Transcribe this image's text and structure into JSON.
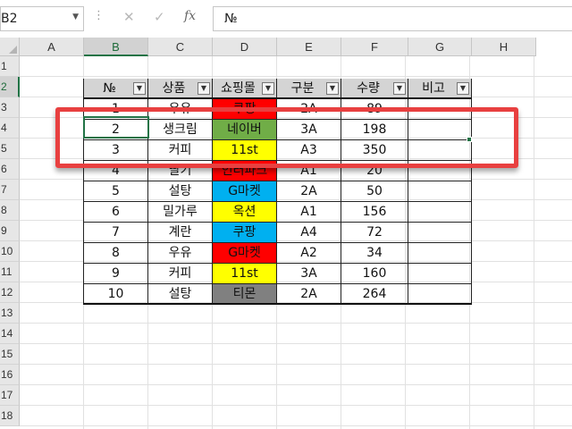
{
  "formula_bar": {
    "name_box": "B2",
    "formula": "№",
    "fx_label": "fx",
    "cancel_icon": "cancel-icon",
    "enter_icon": "enter-icon"
  },
  "columns": [
    "A",
    "B",
    "C",
    "D",
    "E",
    "F",
    "G",
    "H"
  ],
  "rows": [
    "1",
    "2",
    "3",
    "4",
    "5",
    "6",
    "7",
    "8",
    "9",
    "10",
    "11",
    "12",
    "13",
    "14",
    "15",
    "16",
    "17",
    "18"
  ],
  "table": {
    "headers": [
      "№",
      "상품",
      "쇼핑몰",
      "구분",
      "수량",
      "비고"
    ],
    "rows": [
      {
        "no": "1",
        "product": "우유",
        "mall": "쿠팡",
        "category": "2A",
        "qty": "89",
        "note": ""
      },
      {
        "no": "2",
        "product": "생크림",
        "mall": "네이버",
        "category": "3A",
        "qty": "198",
        "note": ""
      },
      {
        "no": "3",
        "product": "커피",
        "mall": "11st",
        "category": "A3",
        "qty": "350",
        "note": ""
      },
      {
        "no": "4",
        "product": "딸기",
        "mall": "인터파크",
        "category": "A1",
        "qty": "20",
        "note": ""
      },
      {
        "no": "5",
        "product": "설탕",
        "mall": "G마켓",
        "category": "2A",
        "qty": "50",
        "note": ""
      },
      {
        "no": "6",
        "product": "밀가루",
        "mall": "옥션",
        "category": "A1",
        "qty": "156",
        "note": ""
      },
      {
        "no": "7",
        "product": "계란",
        "mall": "쿠팡",
        "category": "A4",
        "qty": "72",
        "note": ""
      },
      {
        "no": "8",
        "product": "우유",
        "mall": "G마켓",
        "category": "A2",
        "qty": "34",
        "note": ""
      },
      {
        "no": "9",
        "product": "커피",
        "mall": "11st",
        "category": "3A",
        "qty": "160",
        "note": ""
      },
      {
        "no": "10",
        "product": "설탕",
        "mall": "티몬",
        "category": "2A",
        "qty": "264",
        "note": ""
      }
    ],
    "mall_colors": {
      "쿠팡": "#ff0000",
      "네이버": "#70ad47",
      "11st": "#ffff00",
      "인터파크": "#ff0000",
      "G마켓": "#00b0f0",
      "옥션": "#ffff00",
      "티몬": "#808080"
    },
    "mall_colors_override": {
      "7": "#00b0f0",
      "8": "#ff0000"
    }
  },
  "selection": {
    "cell": "B2"
  },
  "highlight_color": "#e84040"
}
